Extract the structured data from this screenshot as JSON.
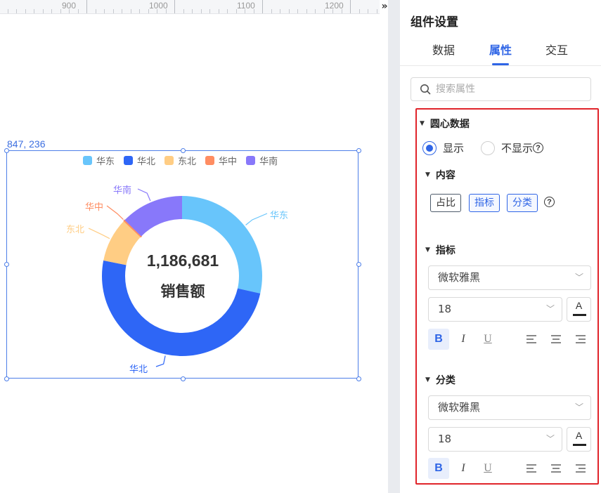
{
  "canvas": {
    "ruler_labels": [
      "900",
      "1000",
      "1100",
      "1200"
    ],
    "coord_label": "847, 236"
  },
  "panel": {
    "title": "组件设置",
    "tabs": [
      {
        "label": "数据"
      },
      {
        "label": "属性"
      },
      {
        "label": "交互"
      }
    ],
    "search_placeholder": "搜索属性",
    "center_section": {
      "title": "圆心数据",
      "radio_show": "显示",
      "radio_hide": "不显示",
      "selected": "显示"
    },
    "content_section": {
      "title": "内容",
      "tags": [
        "占比",
        "指标",
        "分类"
      ],
      "active_tags": [
        "指标",
        "分类"
      ]
    },
    "metric_section": {
      "title": "指标",
      "font": "微软雅黑",
      "size": "18",
      "color_glyph": "A",
      "bold": "B",
      "italic": "I",
      "underline": "U"
    },
    "category_section": {
      "title": "分类",
      "font": "微软雅黑",
      "size": "18",
      "color_glyph": "A",
      "bold": "B",
      "italic": "I",
      "underline": "U"
    },
    "colors": {
      "accent": "#2f65e6",
      "highlight_border": "#e0242a"
    }
  },
  "chart_data": {
    "type": "pie",
    "style": "donut",
    "center_value": "1,186,681",
    "center_label": "销售额",
    "legend_position": "top-center",
    "series": [
      {
        "name": "华东",
        "value": 28.5,
        "color": "#68c5fb"
      },
      {
        "name": "华北",
        "value": 49.6,
        "color": "#2e66f6"
      },
      {
        "name": "东北",
        "value": 9.0,
        "color": "#ffcd84"
      },
      {
        "name": "华中",
        "value": 0.2,
        "color": "#ff8d62"
      },
      {
        "name": "华南",
        "value": 12.7,
        "color": "#8878fa"
      }
    ]
  }
}
